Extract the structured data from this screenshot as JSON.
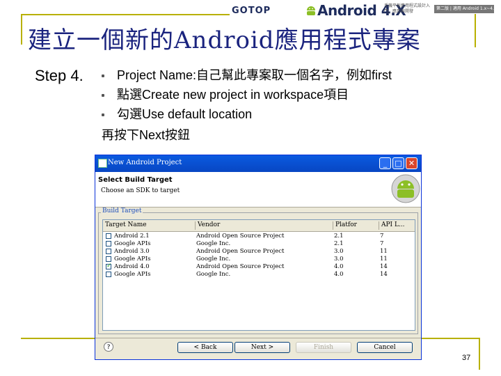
{
  "header": {
    "gotop": "GOTOP",
    "android_logo": "Android 4.X",
    "sub_text": "手機平板應用程式設計入門．應用與開發",
    "badge": "第二版 | 適用 Android 1.x~4.x"
  },
  "slide": {
    "title": "建立一個新的Android應用程式專案",
    "step": "Step 4.",
    "bullets": [
      "Project Name:自己幫此專案取一個名字，例如first",
      "點選Create new project in workspace項目",
      "勾選Use default location"
    ],
    "final": "再按下Next按鈕",
    "page_number": "37"
  },
  "dialog": {
    "title": "New Android Project",
    "heading": "Select Build Target",
    "description": "Choose an SDK to target",
    "group_label": "Build Target",
    "columns": [
      "Target Name",
      "Vendor",
      "Platfor",
      "API L..."
    ],
    "rows": [
      {
        "name": "Android 2.1",
        "vendor": "Android Open Source Project",
        "platform": "2.1",
        "api": "7",
        "checked": false
      },
      {
        "name": "Google APIs",
        "vendor": "Google Inc.",
        "platform": "2.1",
        "api": "7",
        "checked": false
      },
      {
        "name": "Android 3.0",
        "vendor": "Android Open Source Project",
        "platform": "3.0",
        "api": "11",
        "checked": false
      },
      {
        "name": "Google APIs",
        "vendor": "Google Inc.",
        "platform": "3.0",
        "api": "11",
        "checked": false
      },
      {
        "name": "Android 4.0",
        "vendor": "Android Open Source Project",
        "platform": "4.0",
        "api": "14",
        "checked": true
      },
      {
        "name": "Google APIs",
        "vendor": "Google Inc.",
        "platform": "4.0",
        "api": "14",
        "checked": false
      }
    ],
    "buttons": {
      "help": "?",
      "back": "< Back",
      "next": "Next >",
      "finish": "Finish",
      "cancel": "Cancel"
    },
    "titlebar": {
      "minimize": "_",
      "maximize": "□",
      "close": "✕"
    }
  },
  "colors": {
    "title_text": "#1a237e",
    "frame_line": "#b8b000",
    "titlebar": "#0a5ae0"
  }
}
